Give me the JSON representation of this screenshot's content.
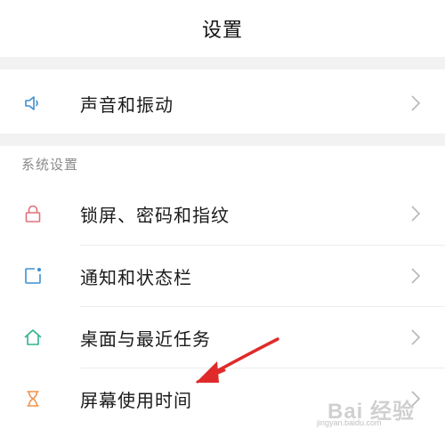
{
  "header": {
    "title": "设置"
  },
  "sections": {
    "system_title": "系统设置"
  },
  "items": [
    {
      "label": "声音和振动",
      "icon": "speaker-icon"
    },
    {
      "label": "锁屏、密码和指纹",
      "icon": "lock-icon"
    },
    {
      "label": "通知和状态栏",
      "icon": "notification-icon"
    },
    {
      "label": "桌面与最近任务",
      "icon": "home-icon"
    },
    {
      "label": "屏幕使用时间",
      "icon": "hourglass-icon"
    }
  ],
  "colors": {
    "speaker": "#3f8fd0",
    "lock": "#e0707a",
    "notification": "#3f8fd0",
    "home": "#2fb38f",
    "hourglass": "#f0924a",
    "annotation_arrow": "#e02a2a"
  },
  "watermark": {
    "main": "Bai 经验",
    "sub": "jingyan.baidu.com"
  }
}
